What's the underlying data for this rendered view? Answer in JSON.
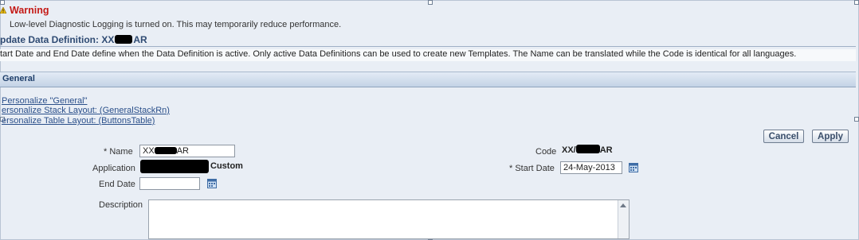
{
  "warning": {
    "title": "Warning",
    "message": "Low-level Diagnostic Logging is turned on. This may temporarily reduce performance."
  },
  "page": {
    "title": "pdate Data Definition: XX",
    "title_suffix": "AR",
    "info": "tart Date and End Date define when the Data Definition is active. Only active Data Definitions can be used to create new Templates. The Name can be translated while the Code is identical for all languages."
  },
  "general": {
    "header": "General",
    "personalize_links": [
      "Personalize \"General\"",
      "ersonalize Stack Layout: (GeneralStackRn)",
      "ersonalize Table Layout: (ButtonsTable)"
    ]
  },
  "buttons": {
    "cancel": "Cancel",
    "apply": "Apply"
  },
  "form": {
    "required_mark": "*",
    "name_label": "Name",
    "name_value_prefix": "XX",
    "name_value_suffix": "AR",
    "application_label": "Application",
    "application_value": "Custom",
    "end_date_label": "End Date",
    "end_date_value": "",
    "description_label": "Description",
    "code_label": "Code",
    "code_value_prefix": "XX/",
    "code_value_suffix": "AR",
    "start_date_label": "Start Date",
    "start_date_value": "24-May-2013"
  },
  "colors": {
    "warning_title": "#c41a16",
    "section_header": "#2f4b73",
    "link": "#2a4f8a",
    "page_background": "#e9eef5"
  },
  "icons": [
    "warning-icon",
    "calendar-icon"
  ]
}
